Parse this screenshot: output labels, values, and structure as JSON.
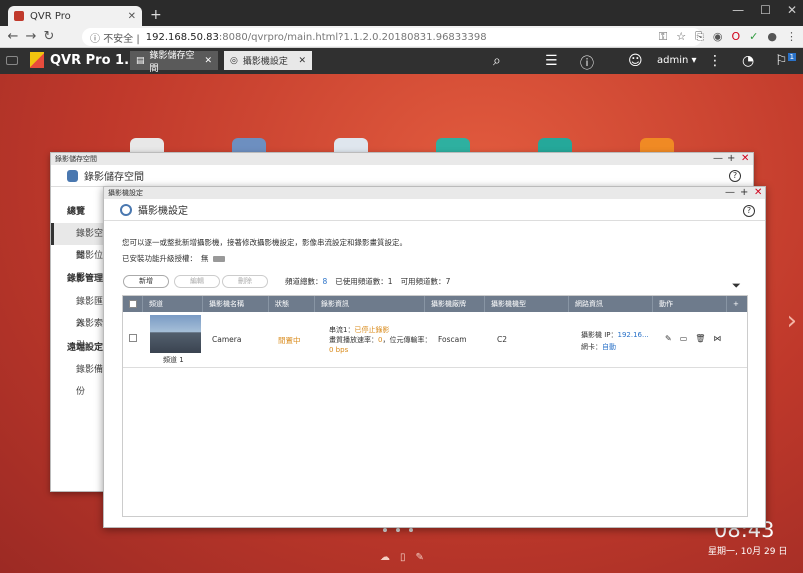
{
  "browser": {
    "tab_title": "QVR Pro",
    "url_secure": "不安全",
    "url_host": "192.168.50.83",
    "url_path": ":8080/qvrpro/main.html?1.1.2.0.20180831.96833398"
  },
  "header": {
    "app_title": "QVR Pro 1.1",
    "tabs": [
      {
        "label": "錄影儲存空間"
      },
      {
        "label": "攝影機設定"
      }
    ],
    "user": "admin",
    "notification_count": "1"
  },
  "storage_window": {
    "bar_title": "錄影儲存空間",
    "title": "錄影儲存空間",
    "sidebar": {
      "overview": "總覽",
      "recording_space": "錄影空間",
      "recording_location": "錄影位置",
      "recording_mgmt": "錄影管理",
      "recording_import": "錄影匯入",
      "recording_search": "錄影索引",
      "remote_settings": "遠端設定",
      "recording_backup": "錄影備份"
    }
  },
  "camera_window": {
    "bar_title": "攝影機設定",
    "title": "攝影機設定",
    "description": "您可以逐一或整批新增攝影機，接著修改攝影機設定，影像串流設定和錄影畫質設定。",
    "upgrade_label": "已安裝功能升級授權：",
    "upgrade_value": "無",
    "buttons": {
      "add": "新增",
      "edit": "編輯",
      "delete": "刪除"
    },
    "counts": {
      "total_label": "頻道總數：",
      "total": "8",
      "used_label": "已使用頻道數：",
      "used": "1",
      "available_label": "可用頻道數：",
      "available": "7"
    },
    "columns": [
      "頻道",
      "攝影機名稱",
      "狀態",
      "錄影資訊",
      "攝影機廠牌",
      "攝影機機型",
      "網路資訊",
      "動作"
    ],
    "rows": [
      {
        "channel": "頻道 1",
        "name": "Camera",
        "status": "閒置中",
        "stream_label": "串流1：",
        "stream_value": "已停止錄影",
        "rate_label": "畫質播放速率：",
        "rate_value": "0",
        "rate_suffix": "，位元傳輸率：",
        "bitrate": "0 bps",
        "brand": "Foscam",
        "model": "C2",
        "ip_label": "攝影機 IP：",
        "ip_value": "192.16...",
        "nic_label": "網卡：",
        "nic_value": "自動"
      }
    ]
  },
  "desktop": {
    "clock": "08:43",
    "date": "星期一, 10月 29 日"
  }
}
